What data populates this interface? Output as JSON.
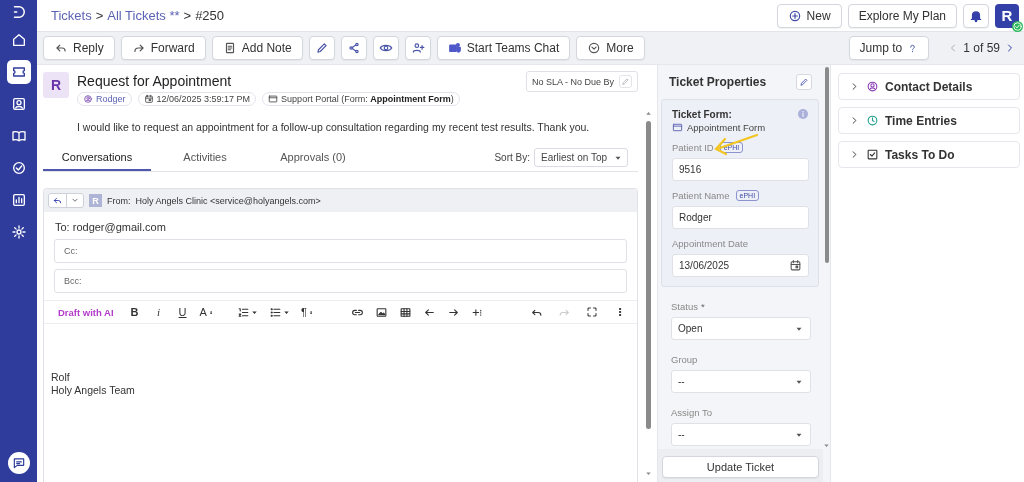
{
  "sidebar": {
    "items": [
      {
        "kind": "home",
        "selected": false
      },
      {
        "kind": "tickets",
        "selected": true
      },
      {
        "kind": "contacts",
        "selected": false
      },
      {
        "kind": "knowledge",
        "selected": false
      },
      {
        "kind": "tasks",
        "selected": false
      },
      {
        "kind": "reports",
        "selected": false
      },
      {
        "kind": "settings",
        "selected": false
      }
    ]
  },
  "breadcrumb": [
    {
      "text": "Tickets",
      "kind": "link"
    },
    {
      "text": ">",
      "kind": "separator"
    },
    {
      "text": "All Tickets **",
      "kind": "link"
    },
    {
      "text": ">",
      "kind": "separator"
    },
    {
      "text": "#250",
      "kind": "current"
    }
  ],
  "header_actions": {
    "new": "New",
    "plan": "Explore My Plan",
    "avatar": "R"
  },
  "toolbar": {
    "buttons": [
      {
        "kind": "reply",
        "label": "Reply"
      },
      {
        "kind": "forward",
        "label": "Forward"
      },
      {
        "kind": "note",
        "label": "Add Note"
      },
      {
        "kind": "edit"
      },
      {
        "kind": "share"
      },
      {
        "kind": "watch"
      },
      {
        "kind": "assign"
      },
      {
        "kind": "teams",
        "label": "Start Teams Chat"
      },
      {
        "kind": "more",
        "label": "More"
      }
    ],
    "jump": "Jump to",
    "pager": "1 of 59"
  },
  "ticket": {
    "avatar": "R",
    "title": "Request for Appointment",
    "requester": "Rodger",
    "created": "12/06/2025 3:59:17 PM",
    "source": "Support Portal (Form: **Appointment Form**)",
    "sla": "No SLA - No Due By",
    "description": "I would like to request an appointment for a follow-up consultation regarding my recent test results. Thank you."
  },
  "tabs": [
    {
      "label": "Conversations",
      "selected": true
    },
    {
      "label": "Activities",
      "selected": false
    },
    {
      "label": "Approvals (0)",
      "selected": false
    }
  ],
  "sort": {
    "label": "Sort By:",
    "value": "Earliest on Top"
  },
  "reply": {
    "avatar": "R",
    "from_label": "From:",
    "from": "Holy Angels Clinic <service@holyangels.com>",
    "to": "To: rodger@gmail.com",
    "cc": {
      "placeholder": "Cc:"
    },
    "bcc": {
      "placeholder": "Bcc:"
    },
    "editor": {
      "ai": "Draft with AI",
      "tools": [
        {
          "kind": "bold",
          "glyph": "B"
        },
        {
          "kind": "italic",
          "glyph": "i"
        },
        {
          "kind": "underline",
          "glyph": "U"
        },
        {
          "kind": "size",
          "glyph": "A"
        },
        {
          "kind": "ordered"
        },
        {
          "kind": "bullets"
        },
        {
          "kind": "paragraph",
          "glyph": "¶"
        },
        {
          "kind": "link"
        },
        {
          "kind": "image"
        },
        {
          "kind": "table"
        },
        {
          "kind": "outdent"
        },
        {
          "kind": "indent"
        },
        {
          "kind": "insert"
        }
      ],
      "history": [
        {
          "kind": "undo",
          "disabled": false
        },
        {
          "kind": "redo",
          "disabled": true
        }
      ],
      "body": [
        "Rolf",
        "Holy Angels Team"
      ]
    }
  },
  "properties": {
    "title": "Ticket Properties",
    "form_label": "Ticket Form:",
    "form_name": "Appointment Form",
    "form_fields": [
      {
        "kind": "text",
        "label": "Patient ID",
        "badge": "ePHI",
        "value": "9516"
      },
      {
        "kind": "text",
        "label": "Patient Name",
        "badge": "ePHI",
        "value": "Rodger"
      },
      {
        "kind": "date",
        "label": "Appointment Date",
        "value": "13/06/2025"
      }
    ],
    "fields": [
      {
        "label": "Status",
        "mark": "*",
        "value": "Open"
      },
      {
        "label": "Group",
        "value": "--"
      },
      {
        "label": "Assign To",
        "value": "--"
      }
    ],
    "submit": "Update Ticket"
  },
  "panels": [
    {
      "kind": "contact",
      "title": "Contact Details",
      "expanded": false
    },
    {
      "kind": "time",
      "title": "Time Entries",
      "expanded": false
    },
    {
      "kind": "tasks",
      "title": "Tasks To Do",
      "expanded": false
    }
  ]
}
